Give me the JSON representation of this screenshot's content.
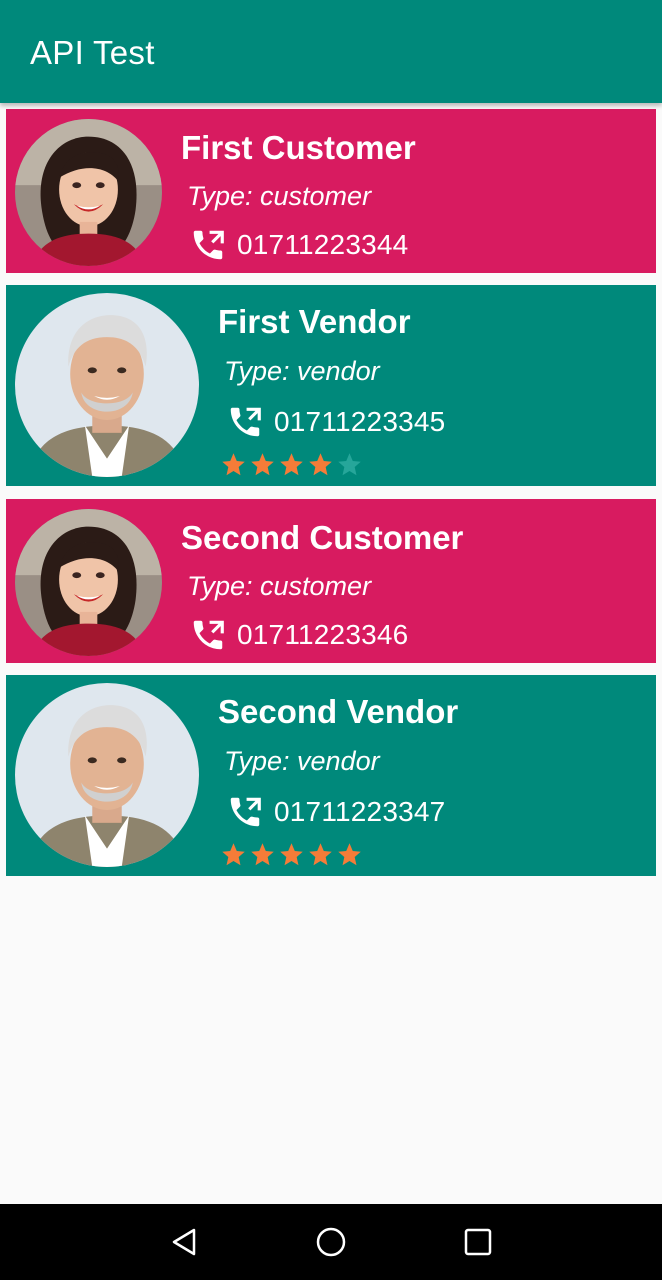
{
  "app": {
    "title": "API Test"
  },
  "colors": {
    "customer_bg": "#d81b60",
    "vendor_bg": "#00897b",
    "star_filled": "#f57c38",
    "star_empty": "#26a69a"
  },
  "cards": [
    {
      "kind": "customer",
      "name": "First Customer",
      "type": "Type: customer",
      "phone": "01711223344",
      "avatar": "woman-avatar"
    },
    {
      "kind": "vendor",
      "name": "First Vendor",
      "type": "Type: vendor",
      "phone": "01711223345",
      "avatar": "man-avatar",
      "rating": 4,
      "rating_max": 5
    },
    {
      "kind": "customer",
      "name": "Second Customer",
      "type": "Type: customer",
      "phone": "01711223346",
      "avatar": "woman-avatar"
    },
    {
      "kind": "vendor",
      "name": "Second Vendor",
      "type": "Type: vendor",
      "phone": "01711223347",
      "avatar": "man-avatar",
      "rating": 5,
      "rating_max": 5
    }
  ],
  "nav": {
    "back_icon": "back-triangle-icon",
    "home_icon": "home-circle-icon",
    "recents_icon": "recents-square-icon"
  }
}
